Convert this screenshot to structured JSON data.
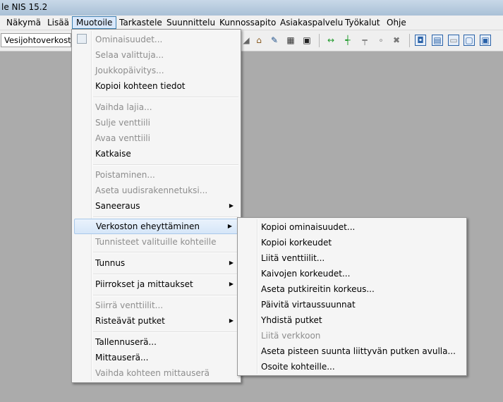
{
  "window": {
    "title": "le NIS 15.2"
  },
  "menubar": [
    "Näkymä",
    "Lisää",
    "Muotoile",
    "Tarkastele",
    "Suunnittelu",
    "Kunnossapito",
    "Asiakaspalvelu",
    "Työkalut",
    "Ohje"
  ],
  "toolbar": {
    "layer_combo": "Vesijohtoverkosto"
  },
  "muotoile_menu": {
    "g1": [
      "Ominaisuudet...",
      "Selaa valittuja...",
      "Joukkopäivitys...",
      "Kopioi kohteen tiedot"
    ],
    "g2": [
      "Vaihda lajia...",
      "Sulje venttiili",
      "Avaa venttiili",
      "Katkaise"
    ],
    "g3": [
      "Poistaminen...",
      "Aseta uudisrakennetuksi...",
      "Saneeraus"
    ],
    "g4": [
      "Verkoston eheyttäminen",
      "Tunnisteet valituille kohteille"
    ],
    "g5": [
      "Tunnus"
    ],
    "g6": [
      "Piirrokset ja mittaukset"
    ],
    "g7": [
      "Siirrä venttiilit...",
      "Risteävät putket"
    ],
    "g8": [
      "Tallennuserä...",
      "Mittauserä...",
      "Vaihda kohteen mittauserä"
    ]
  },
  "submenu": [
    "Kopioi ominaisuudet...",
    "Kopioi korkeudet",
    "Liitä venttiilit...",
    "Kaivojen korkeudet...",
    "Aseta putkireitin korkeus...",
    "Päivitä virtaussuunnat",
    "Yhdistä putket",
    "Liitä verkkoon",
    "Aseta pisteen suunta liittyvän putken avulla...",
    "Osoite kohteille..."
  ],
  "arrow_glyph": "▶"
}
